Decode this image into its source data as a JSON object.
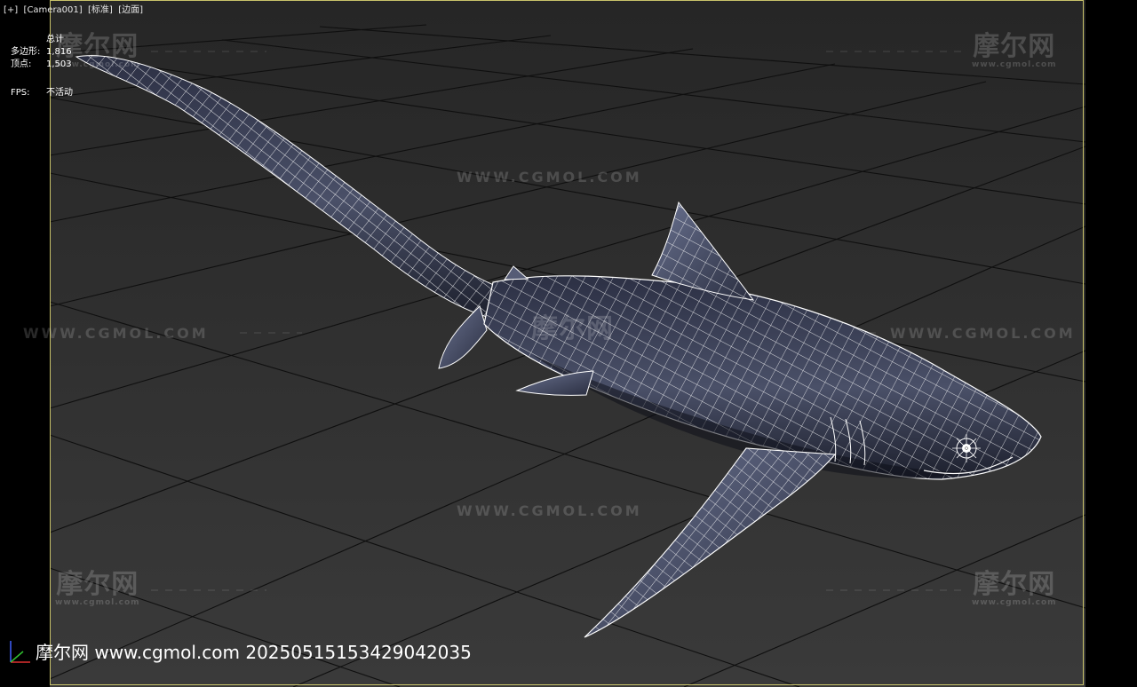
{
  "viewport": {
    "label": "[+]  [Camera001]  [标准]  [边面]",
    "border_color": "#c9c36a",
    "background_color": "#222222",
    "grid_color": "#0e0e0e"
  },
  "stats": {
    "header": "总计",
    "polygons_label": "多边形:",
    "polygons_value": "1,816",
    "vertices_label": "顶点:",
    "vertices_value": "1,503",
    "fps_label": "FPS:",
    "fps_value": "不活动"
  },
  "model": {
    "name": "shark",
    "body_color": "#3a3f55",
    "wire_color": "#ffffff"
  },
  "watermarks": {
    "logo": "摩尔网",
    "logo_sub": "www.cgmol.com",
    "site_line": "WWW.CGMOL.COM"
  },
  "footer": {
    "stamp": "摩尔网 www.cgmol.com 20250515153429042035"
  },
  "gizmo": {
    "icon": "axis-gizmo-icon",
    "x_color": "#e03030",
    "y_color": "#30c030",
    "z_color": "#4060ff"
  }
}
